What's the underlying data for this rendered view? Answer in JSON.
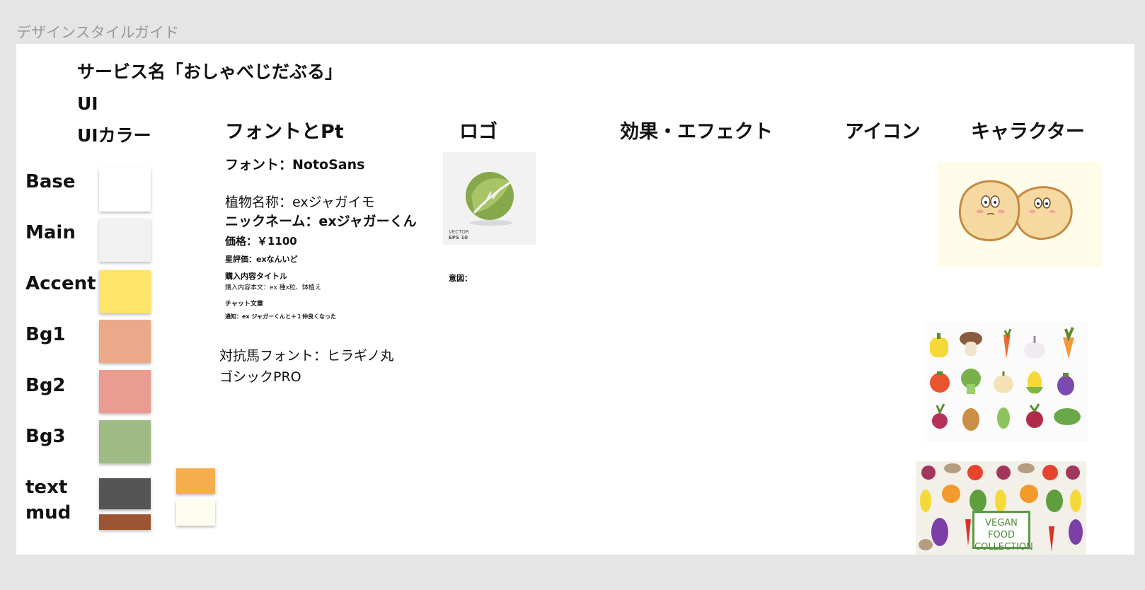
{
  "frame_label": "デザインスタイルガイド",
  "service_title": "サービス名「おしゃべじだぶる」",
  "ui_label": "UI",
  "ui_color_label": "UIカラー",
  "sections": {
    "font": "フォントとPt",
    "logo": "ロゴ",
    "effect": "効果・エフェクト",
    "icon": "アイコン",
    "character": "キャラクター"
  },
  "colors": [
    {
      "label": "Base",
      "hex": "#ffffff"
    },
    {
      "label": "Main",
      "hex": "#f1f1f1"
    },
    {
      "label": "Accent",
      "hex": "#ffe36b"
    },
    {
      "label": "Bg1",
      "hex": "#eba98a"
    },
    {
      "label": "Bg2",
      "hex": "#eb9c90"
    },
    {
      "label": "Bg3",
      "hex": "#9fbb85"
    },
    {
      "label": "text",
      "hex": "#555555"
    },
    {
      "label": "mud",
      "hex": "#9c5532"
    }
  ],
  "extra_colors": [
    {
      "hex": "#f6ad4d"
    },
    {
      "hex": "#fefdf0"
    }
  ],
  "font_samples": {
    "font": "フォント：NotoSans",
    "plant_name": "植物名称：exジャガイモ",
    "nickname": "ニックネーム：exジャガーくん",
    "price": "価格：￥1100",
    "rating": "星評価：exなんいど",
    "purchase_title": "購入内容タイトル",
    "purchase_body": "購入内容本文：ex 種x粒、鉢植え",
    "chat": "チャット文章",
    "notification": "通知：ex ジャガーくんと＋１仲良くなった",
    "alt_font_line1": "対抗馬フォント：ヒラギノ丸",
    "alt_font_line2": "ゴシックPRO"
  },
  "logo": {
    "tag_line1": "VECTOR",
    "tag_line2": "EPS 10",
    "intent": "意図："
  },
  "pattern": {
    "line1": "VEGAN FOOD",
    "line2": "COLLECTION"
  }
}
